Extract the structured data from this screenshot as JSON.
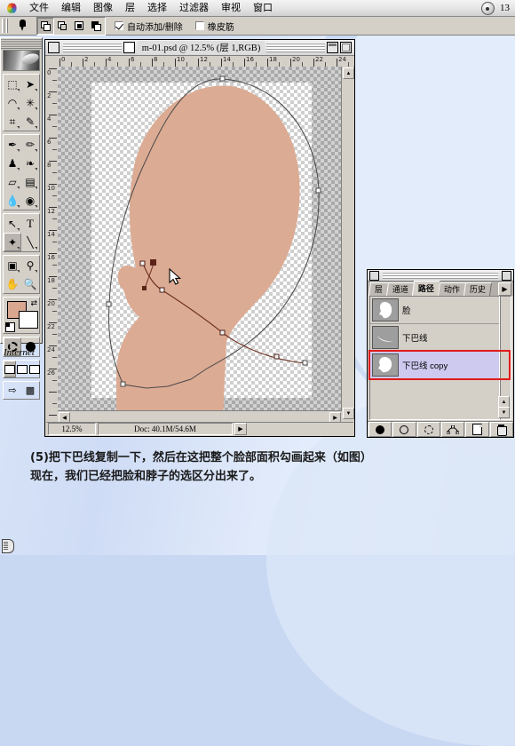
{
  "app": {
    "menu_items": [
      "文件",
      "编辑",
      "图像",
      "层",
      "选择",
      "过滤器",
      "审视",
      "窗口"
    ],
    "menu_right_count": "13"
  },
  "options_bar": {
    "tool_icon": "pen-tool-icon",
    "shape_modes": [
      "add-to-shape",
      "subtract-from-shape",
      "intersect-shape",
      "exclude-shape"
    ],
    "auto_add_delete": {
      "label": "自动添加/删除",
      "checked": true
    },
    "rubber_band": {
      "label": "橡皮筋",
      "checked": false
    }
  },
  "toolbox": {
    "tools": [
      "marquee",
      "move",
      "lasso",
      "magic-wand",
      "crop",
      "eyedropper-slice",
      "airbrush",
      "paintbrush",
      "stamp",
      "history-brush",
      "eraser",
      "gradient",
      "blur",
      "dodge",
      "path-select",
      "type",
      "pen",
      "line",
      "shape",
      "eyedropper",
      "hand",
      "zoom"
    ],
    "selected_tool": "pen",
    "foreground_color": "#d9a78f",
    "background_color": "#ffffff",
    "internet_label": "Internet"
  },
  "document": {
    "title": "m-01.psd @ 12.5% (层 1,RGB)",
    "zoom": "12.5%",
    "doc_info": "Doc: 40.1M/54.6M",
    "ruler_unit_labels_h": [
      "0",
      "2",
      "4",
      "6",
      "8",
      "10",
      "12",
      "14",
      "16",
      "18",
      "20",
      "22",
      "24"
    ],
    "ruler_unit_labels_v": [
      "0",
      "2",
      "4",
      "6",
      "8",
      "10",
      "12",
      "14",
      "16",
      "18",
      "20",
      "22",
      "24",
      "26"
    ],
    "layer_tag": "01",
    "skin_color": "#dcab93",
    "path_stroke": "#3a3a3a",
    "active_path_stroke": "#6b2f20"
  },
  "palette": {
    "tabs": [
      {
        "label": "层",
        "active": false
      },
      {
        "label": "通道",
        "active": false
      },
      {
        "label": "路径",
        "active": true
      },
      {
        "label": "动作",
        "active": false
      },
      {
        "label": "历史",
        "active": false
      }
    ],
    "rows": [
      {
        "name": "脸",
        "selected": false
      },
      {
        "name": "下巴线",
        "selected": false
      },
      {
        "name": "下巴线 copy",
        "selected": true
      }
    ],
    "highlight_color": "#e01b1b",
    "bottom_buttons": [
      "fill-path-icon",
      "stroke-path-icon",
      "load-selection-icon",
      "make-work-path-icon",
      "new-path-icon",
      "delete-path-icon"
    ]
  },
  "caption": {
    "line1": "(5)把下巴线复制一下，然后在这把整个脸部面积勾画起来（如图）",
    "line2": "现在，我们已经把脸和脖子的选区分出来了。"
  }
}
